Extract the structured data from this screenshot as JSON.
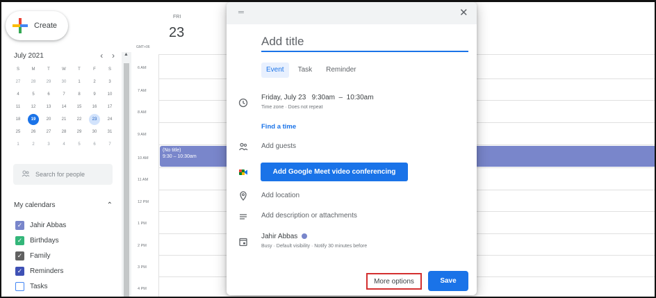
{
  "sidebar": {
    "create_label": "Create",
    "month_title": "July 2021",
    "prev_arrow": "‹",
    "next_arrow": "›",
    "weekdays": [
      "S",
      "M",
      "T",
      "W",
      "T",
      "F",
      "S"
    ],
    "weeks": [
      [
        "27",
        "28",
        "29",
        "30",
        "1",
        "2",
        "3"
      ],
      [
        "4",
        "5",
        "6",
        "7",
        "8",
        "9",
        "10"
      ],
      [
        "11",
        "12",
        "13",
        "14",
        "15",
        "16",
        "17"
      ],
      [
        "18",
        "19",
        "20",
        "21",
        "22",
        "23",
        "24"
      ],
      [
        "25",
        "26",
        "27",
        "28",
        "29",
        "30",
        "31"
      ],
      [
        "1",
        "2",
        "3",
        "4",
        "5",
        "6",
        "7"
      ]
    ],
    "search_placeholder": "Search for people",
    "my_calendars_label": "My calendars",
    "calendars": [
      {
        "label": "Jahir Abbas",
        "color": "#7986cb",
        "checked": true
      },
      {
        "label": "Birthdays",
        "color": "#33b679",
        "checked": true
      },
      {
        "label": "Family",
        "color": "#616161",
        "checked": true
      },
      {
        "label": "Reminders",
        "color": "#3f51b5",
        "checked": true
      },
      {
        "label": "Tasks",
        "color": "#4285f4",
        "checked": false
      }
    ]
  },
  "grid": {
    "day_label": "FRI",
    "day_number": "23",
    "timezone": "GMT+06",
    "hours": [
      "6 AM",
      "7 AM",
      "8 AM",
      "9 AM",
      "10 AM",
      "11 AM",
      "12 PM",
      "1 PM",
      "2 PM",
      "3 PM",
      "4 PM"
    ],
    "event_title": "(No title)",
    "event_time": "9:30 – 10:30am"
  },
  "dialog": {
    "title_placeholder": "Add title",
    "tabs": [
      "Event",
      "Task",
      "Reminder"
    ],
    "date_time": "Friday, July 23   9:30am  –  10:30am",
    "time_zone_note": "Time zone · Does not repeat",
    "find_time": "Find a time",
    "add_guests": "Add guests",
    "meet_button": "Add Google Meet video conferencing",
    "add_location": "Add location",
    "add_description": "Add description or attachments",
    "owner_name": "Jahir Abbas",
    "owner_details": "Busy · Default visibility · Notify 30 minutes before",
    "more_options": "More options",
    "save": "Save",
    "close_glyph": "✕",
    "drag_glyph": "═"
  },
  "colors": {
    "accent": "#1a73e8",
    "event": "#7986cb",
    "highlight_border": "#d32f2f"
  }
}
